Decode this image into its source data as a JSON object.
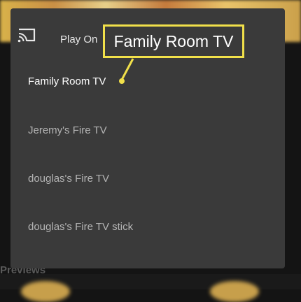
{
  "background": {
    "previews_label": "Previews"
  },
  "dialog": {
    "play_on_label": "Play On",
    "cast_icon": "cast-icon",
    "devices": [
      {
        "label": "Family Room TV",
        "selected": true
      },
      {
        "label": "Jeremy's Fire TV",
        "selected": false
      },
      {
        "label": "douglas's Fire TV",
        "selected": false
      },
      {
        "label": "douglas's Fire TV stick",
        "selected": false
      }
    ]
  },
  "callout": {
    "text": "Family Room TV",
    "color": "#f1e04a"
  }
}
